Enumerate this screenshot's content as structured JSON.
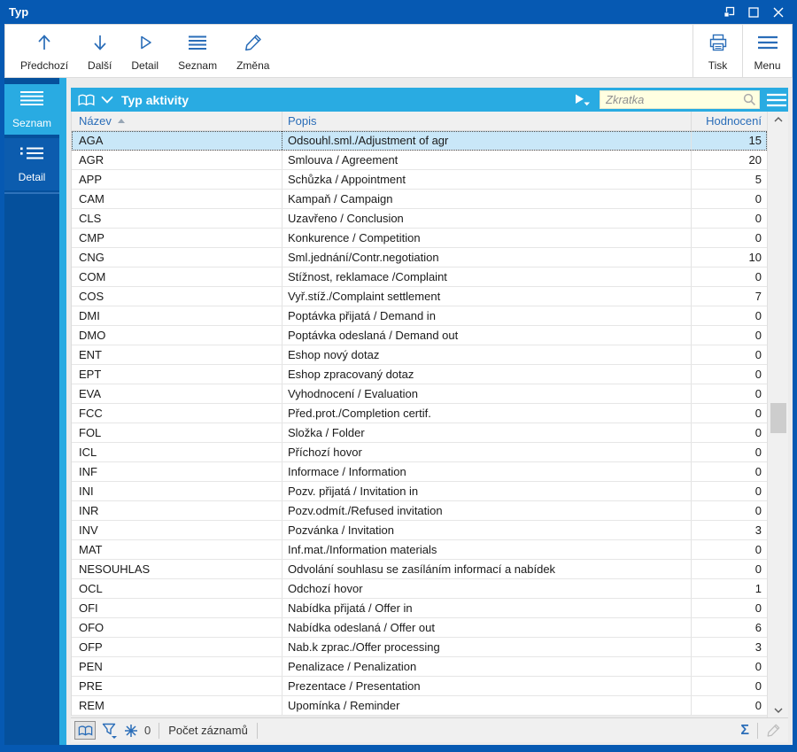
{
  "window": {
    "title": "Typ"
  },
  "titlebar": {
    "controls": [
      "dock",
      "maximize",
      "close"
    ]
  },
  "toolbar": {
    "items": [
      {
        "label": "Předchozí",
        "icon": "arrow-up-icon"
      },
      {
        "label": "Další",
        "icon": "arrow-down-icon"
      },
      {
        "label": "Detail",
        "icon": "triangle-right-icon"
      },
      {
        "label": "Seznam",
        "icon": "list-icon"
      },
      {
        "label": "Změna",
        "icon": "pencil-icon"
      }
    ],
    "right_items": [
      {
        "label": "Tisk",
        "icon": "printer-icon"
      },
      {
        "label": "Menu",
        "icon": "hamburger-icon"
      }
    ]
  },
  "sidebar": {
    "tabs": [
      {
        "label": "Seznam",
        "icon": "list-icon",
        "active": true
      },
      {
        "label": "Detail",
        "icon": "detail-list-icon",
        "active": false
      }
    ]
  },
  "panel": {
    "title": "Typ aktivity",
    "icons": [
      "open-book-icon",
      "chevron-down-icon",
      "play-icon",
      "hamburger-icon"
    ],
    "search": {
      "placeholder": "Zkratka",
      "value": "",
      "icon": "magnifier-icon"
    }
  },
  "table": {
    "columns": [
      {
        "label": "Název",
        "sort": "asc"
      },
      {
        "label": "Popis",
        "sort": null
      },
      {
        "label": "Hodnocení",
        "sort": null,
        "align": "right"
      }
    ],
    "selected_row": 0,
    "rows": [
      {
        "nazev": "AGA",
        "popis": "Odsouhl.sml./Adjustment of agr",
        "hodnoceni": "15"
      },
      {
        "nazev": "AGR",
        "popis": "Smlouva / Agreement",
        "hodnoceni": "20"
      },
      {
        "nazev": "APP",
        "popis": "Schůzka / Appointment",
        "hodnoceni": "5"
      },
      {
        "nazev": "CAM",
        "popis": "Kampaň / Campaign",
        "hodnoceni": "0"
      },
      {
        "nazev": "CLS",
        "popis": "Uzavřeno / Conclusion",
        "hodnoceni": "0"
      },
      {
        "nazev": "CMP",
        "popis": "Konkurence / Competition",
        "hodnoceni": "0"
      },
      {
        "nazev": "CNG",
        "popis": "Sml.jednání/Contr.negotiation",
        "hodnoceni": "10"
      },
      {
        "nazev": "COM",
        "popis": "Stížnost, reklamace /Complaint",
        "hodnoceni": "0"
      },
      {
        "nazev": "COS",
        "popis": "Vyř.stíž./Complaint settlement",
        "hodnoceni": "7"
      },
      {
        "nazev": "DMI",
        "popis": "Poptávka přijatá / Demand in",
        "hodnoceni": "0"
      },
      {
        "nazev": "DMO",
        "popis": "Poptávka odeslaná / Demand out",
        "hodnoceni": "0"
      },
      {
        "nazev": "ENT",
        "popis": "Eshop nový dotaz",
        "hodnoceni": "0"
      },
      {
        "nazev": "EPT",
        "popis": "Eshop zpracovaný dotaz",
        "hodnoceni": "0"
      },
      {
        "nazev": "EVA",
        "popis": "Vyhodnocení / Evaluation",
        "hodnoceni": "0"
      },
      {
        "nazev": "FCC",
        "popis": "Před.prot./Completion certif.",
        "hodnoceni": "0"
      },
      {
        "nazev": "FOL",
        "popis": "Složka / Folder",
        "hodnoceni": "0"
      },
      {
        "nazev": "ICL",
        "popis": "Příchozí hovor",
        "hodnoceni": "0"
      },
      {
        "nazev": "INF",
        "popis": "Informace / Information",
        "hodnoceni": "0"
      },
      {
        "nazev": "INI",
        "popis": "Pozv. přijatá / Invitation in",
        "hodnoceni": "0"
      },
      {
        "nazev": "INR",
        "popis": "Pozv.odmít./Refused invitation",
        "hodnoceni": "0"
      },
      {
        "nazev": "INV",
        "popis": "Pozvánka / Invitation",
        "hodnoceni": "3"
      },
      {
        "nazev": "MAT",
        "popis": "Inf.mat./Information materials",
        "hodnoceni": "0"
      },
      {
        "nazev": "NESOUHLAS",
        "popis": "Odvolání souhlasu se zasíláním informací a nabídek",
        "hodnoceni": "0"
      },
      {
        "nazev": "OCL",
        "popis": "Odchozí hovor",
        "hodnoceni": "1"
      },
      {
        "nazev": "OFI",
        "popis": "Nabídka přijatá / Offer in",
        "hodnoceni": "0"
      },
      {
        "nazev": "OFO",
        "popis": "Nabídka odeslaná / Offer out",
        "hodnoceni": "6"
      },
      {
        "nazev": "OFP",
        "popis": "Nab.k zprac./Offer processing",
        "hodnoceni": "3"
      },
      {
        "nazev": "PEN",
        "popis": "Penalizace / Penalization",
        "hodnoceni": "0"
      },
      {
        "nazev": "PRE",
        "popis": "Prezentace / Presentation",
        "hodnoceni": "0"
      },
      {
        "nazev": "REM",
        "popis": "Upomínka / Reminder",
        "hodnoceni": "0"
      }
    ]
  },
  "statusbar": {
    "icons": [
      "open-book-icon",
      "filter-icon",
      "snowflake-icon",
      "sigma-icon",
      "pencil-icon"
    ],
    "filter_count": "0",
    "record_count_label": "Počet záznamů"
  },
  "colors": {
    "titlebar_blue": "#0659b2",
    "sidebar_blue": "#05509c",
    "accent_cyan": "#29abe2",
    "icon_blue": "#2a6db8",
    "selected_row_bg": "#c9e7f8",
    "search_bg": "#ffffe1"
  }
}
